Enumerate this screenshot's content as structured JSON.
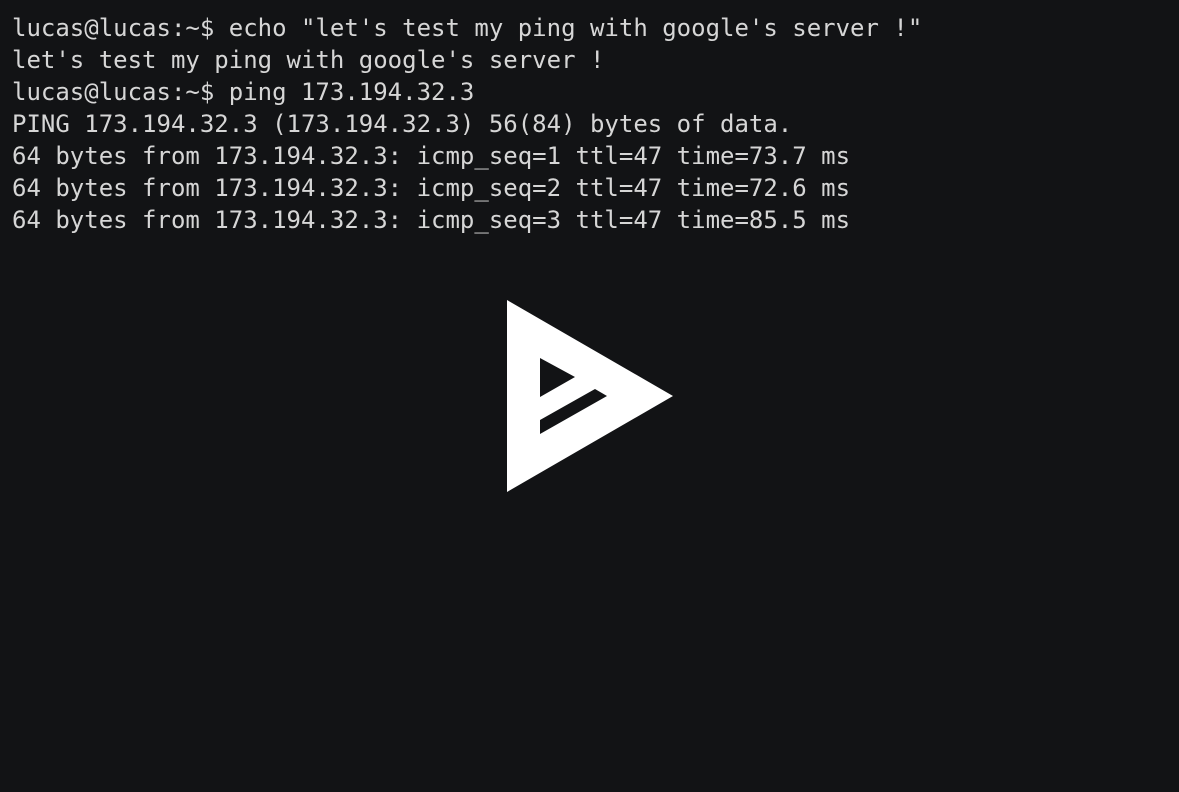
{
  "terminal": {
    "lines": [
      "lucas@lucas:~$ echo \"let's test my ping with google's server !\"",
      "let's test my ping with google's server !",
      "lucas@lucas:~$ ping 173.194.32.3",
      "PING 173.194.32.3 (173.194.32.3) 56(84) bytes of data.",
      "64 bytes from 173.194.32.3: icmp_seq=1 ttl=47 time=73.7 ms",
      "64 bytes from 173.194.32.3: icmp_seq=2 ttl=47 time=72.6 ms",
      "64 bytes from 173.194.32.3: icmp_seq=3 ttl=47 time=85.5 ms"
    ]
  },
  "colors": {
    "background": "#121315",
    "text": "#d6d6d6",
    "play_icon": "#ffffff"
  },
  "overlay": {
    "icon": "asciinema-play-icon"
  }
}
